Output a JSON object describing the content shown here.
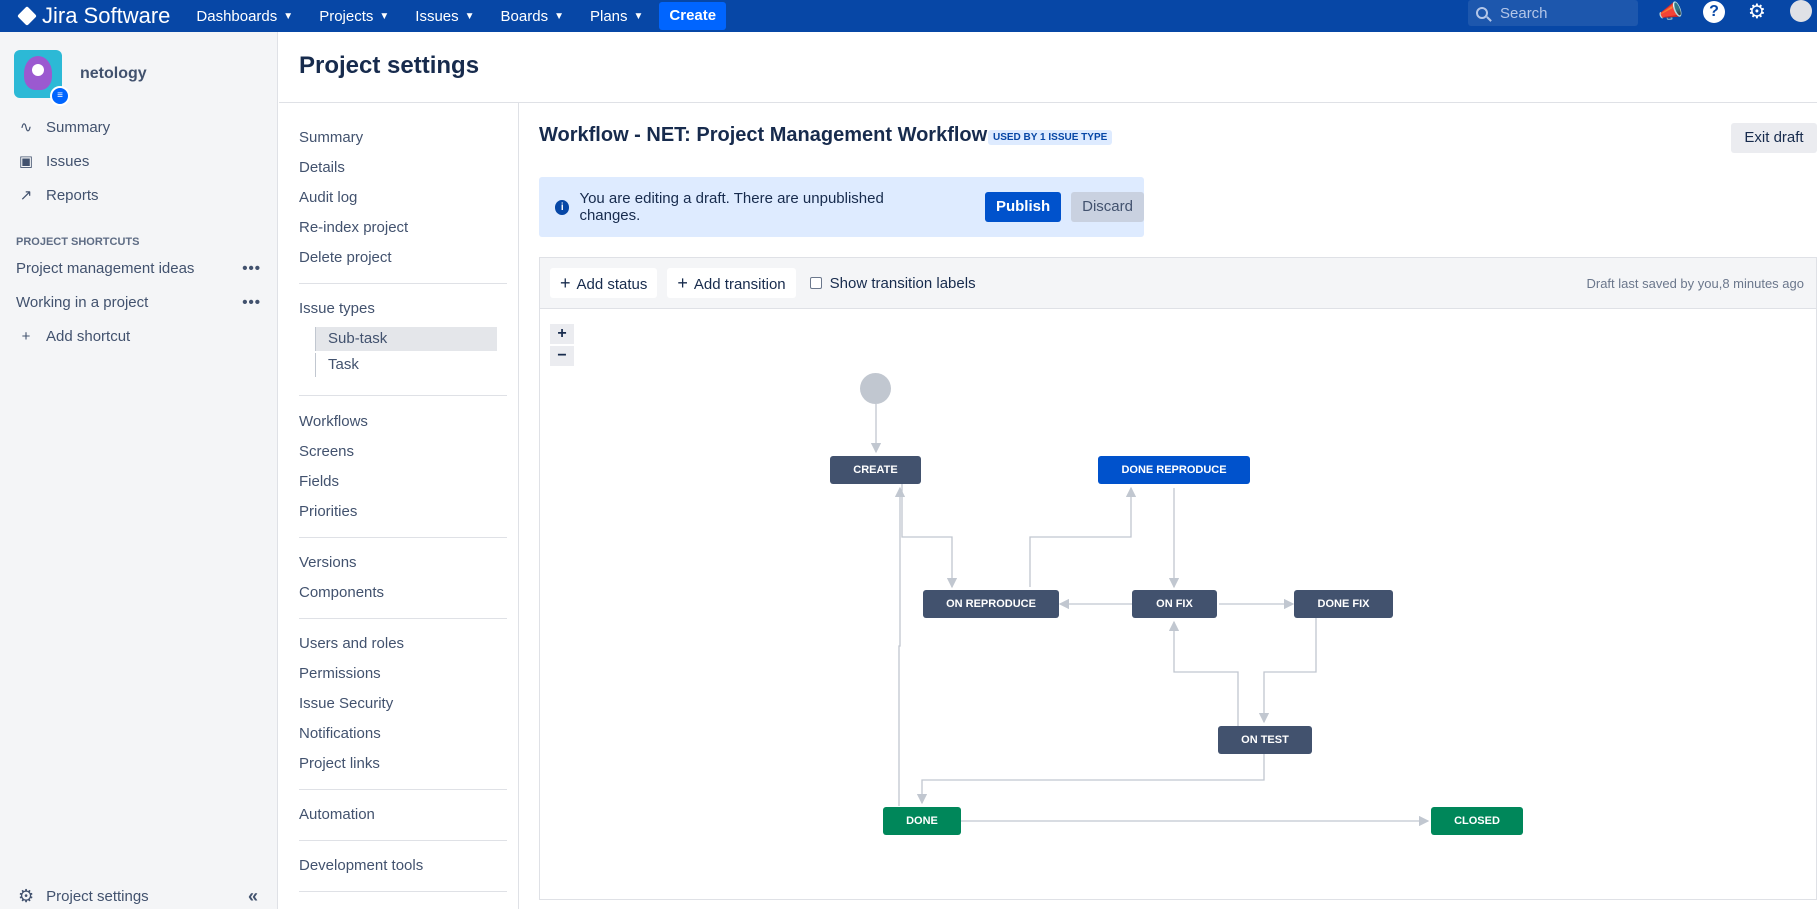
{
  "topnav": {
    "app_name": "Jira Software",
    "items": [
      "Dashboards",
      "Projects",
      "Issues",
      "Boards",
      "Plans"
    ],
    "create_label": "Create",
    "search_placeholder": "Search"
  },
  "sidebar": {
    "project_name": "netology",
    "items": [
      {
        "label": "Summary",
        "icon": "pulse-icon"
      },
      {
        "label": "Issues",
        "icon": "issues-icon"
      },
      {
        "label": "Reports",
        "icon": "chart-icon"
      }
    ],
    "shortcuts_heading": "PROJECT SHORTCUTS",
    "shortcuts": [
      "Project management ideas",
      "Working in a project"
    ],
    "add_shortcut": "Add shortcut",
    "footer_label": "Project settings"
  },
  "page": {
    "title": "Project settings"
  },
  "settings_nav": {
    "group1": [
      "Summary",
      "Details",
      "Audit log",
      "Re-index project",
      "Delete project"
    ],
    "issue_types_label": "Issue types",
    "issue_types": [
      "Sub-task",
      "Task"
    ],
    "group2": [
      "Workflows",
      "Screens",
      "Fields",
      "Priorities"
    ],
    "group3": [
      "Versions",
      "Components"
    ],
    "group4": [
      "Users and roles",
      "Permissions",
      "Issue Security",
      "Notifications",
      "Project links"
    ],
    "group5": [
      "Automation"
    ],
    "group6": [
      "Development tools"
    ]
  },
  "workflow": {
    "title": "Workflow - NET: Project Management Workflow",
    "badge": "USED BY 1 ISSUE TYPE",
    "exit_draft": "Exit draft",
    "banner_text": "You are editing a draft. There are unpublished changes.",
    "publish": "Publish",
    "discard": "Discard",
    "add_status": "Add status",
    "add_transition": "Add transition",
    "show_labels": "Show transition labels",
    "saved_text": "Draft last saved by you,8 minutes ago",
    "zoom_in": "+",
    "zoom_out": "−",
    "statuses": {
      "create": "CREATE",
      "done_reproduce": "DONE REPRODUCE",
      "on_reproduce": "ON REPRODUCE",
      "on_fix": "ON FIX",
      "done_fix": "DONE FIX",
      "on_test": "ON TEST",
      "done": "DONE",
      "closed": "CLOSED"
    }
  },
  "colors": {
    "nav_bg": "#0747a6",
    "status_grey": "#42526e",
    "status_blue": "#0052cc",
    "status_green": "#00875a"
  }
}
